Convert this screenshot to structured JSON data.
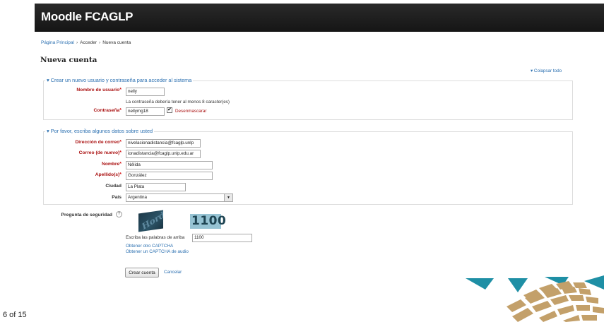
{
  "header": {
    "site_title": "Moodle FCAGLP"
  },
  "breadcrumb": {
    "items": [
      "Página Principal",
      "Acceder",
      "Nueva cuenta"
    ],
    "separator": "›"
  },
  "page": {
    "heading": "Nueva cuenta",
    "collapse_all": "Colapsar todo"
  },
  "section_account": {
    "legend": "Crear un nuevo usuario y contraseña para acceder al sistema",
    "username_label": "Nombre de usuario",
    "username_value": "nelly",
    "password_hint": "La contraseña debería tener al menos 8 caracter(es)",
    "password_label": "Contraseña",
    "password_value": "nellymg18",
    "unmask_label": "Desenmascarar",
    "unmask_checked": true
  },
  "section_details": {
    "legend": "Por favor, escriba algunos datos sobre usted",
    "email_label": "Dirección de correo",
    "email_value": "nivelacionadistancia@fcaglp.unlp",
    "email2_label": "Correo (de nuevo)",
    "email2_value": "ionadistancia@fcaglp.unlp.edu.ar",
    "firstname_label": "Nombre",
    "firstname_value": "Nélida",
    "lastname_label": "Apellido(s)",
    "lastname_value": "González",
    "city_label": "Ciudad",
    "city_value": "La Plata",
    "country_label": "País",
    "country_value": "Argentina"
  },
  "captcha": {
    "label": "Pregunta de seguridad",
    "word1": "Hord",
    "word2": "1100",
    "prompt": "Escriba las palabras de arriba",
    "answer": "1100",
    "other_captcha": "Obtener otro CAPTCHA",
    "audio_captcha": "Obtener un CAPTCHA de audio"
  },
  "actions": {
    "submit": "Crear cuenta",
    "cancel": "Cancelar"
  },
  "footer": {
    "page_indicator": "6 of 15"
  },
  "colors": {
    "header_bg": "#1f1f1f",
    "link": "#2a6fb0",
    "required": "#aa1111",
    "logo_teal": "#1e8fa5",
    "logo_gold": "#c3a06a"
  }
}
